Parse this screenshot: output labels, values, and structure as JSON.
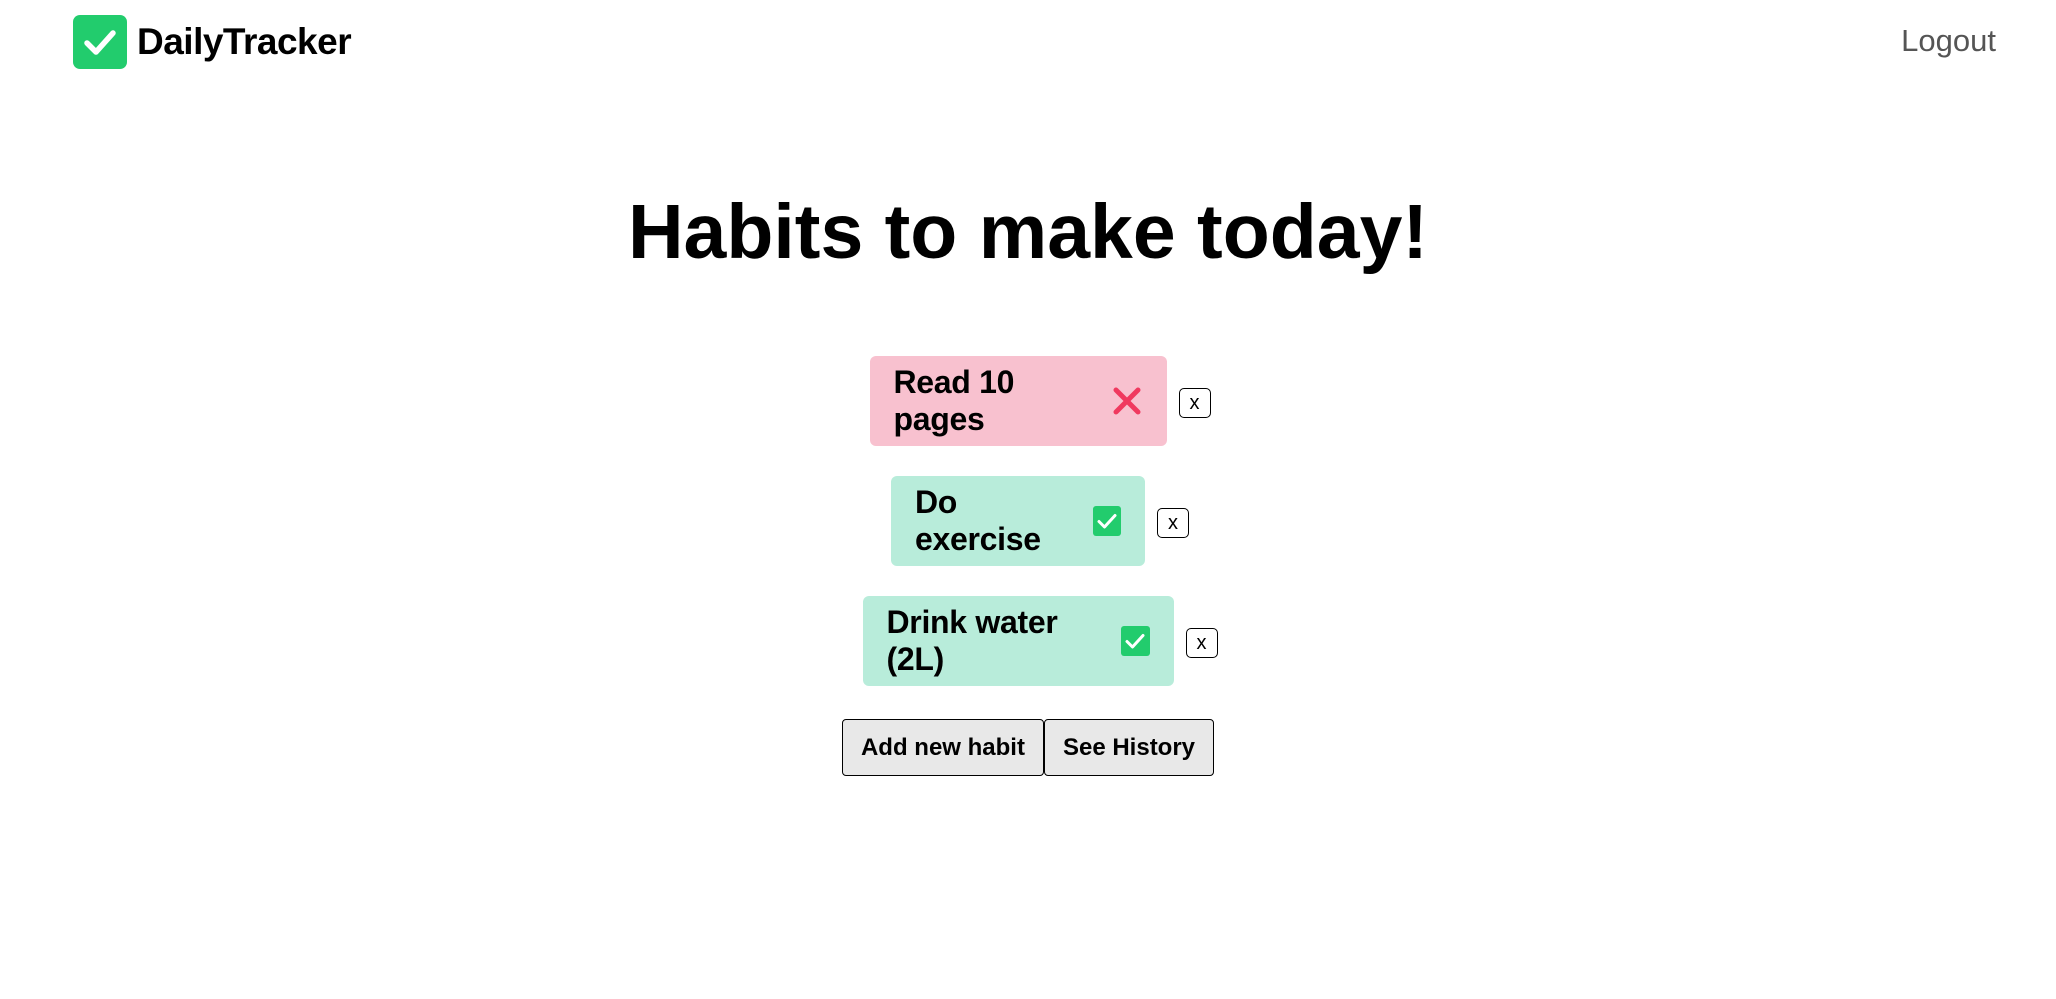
{
  "header": {
    "brand_name": "DailyTracker",
    "logout_label": "Logout"
  },
  "main": {
    "title": "Habits to make today!",
    "habits": [
      {
        "label": "Read 10 pages",
        "status": "not-done",
        "delete_label": "x"
      },
      {
        "label": "Do exercise",
        "status": "done",
        "delete_label": "x"
      },
      {
        "label": "Drink water (2L)",
        "status": "done",
        "delete_label": "x"
      }
    ],
    "actions": {
      "add_label": "Add new habit",
      "history_label": "See History"
    }
  },
  "colors": {
    "brand_green": "#22cc6d",
    "pending_bg": "#f8c1cf",
    "done_bg": "#b8ecda",
    "cross_red": "#f0395f"
  },
  "icons": {
    "brand": "check-square-icon",
    "not_done": "cross-icon",
    "done": "check-square-icon"
  }
}
